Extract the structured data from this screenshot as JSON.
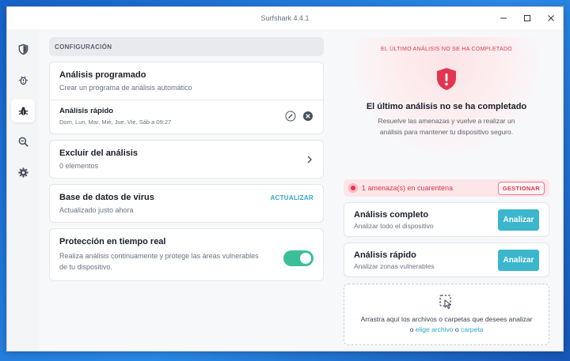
{
  "window": {
    "title": "Surfshark 4.4.1"
  },
  "sidebar": {
    "items": [
      {
        "name": "vpn",
        "icon": "shield-icon"
      },
      {
        "name": "alert",
        "icon": "alert-bug-icon"
      },
      {
        "name": "antivirus",
        "icon": "bug-icon",
        "active": true
      },
      {
        "name": "search",
        "icon": "search-icon"
      },
      {
        "name": "settings",
        "icon": "gear-icon"
      }
    ]
  },
  "config": {
    "header": "CONFIGURACIÓN",
    "scheduled": {
      "title": "Análisis programado",
      "subtitle": "Crear un programa de análisis automático",
      "item": {
        "title": "Análisis rápido",
        "days": "Dom, Lun, Mar, Mié, Jue, Vie, Sáb a 09:27"
      }
    },
    "exclude": {
      "title": "Excluir del análisis",
      "subtitle": "0 elementos"
    },
    "database": {
      "title": "Base de datos de virus",
      "subtitle": "Actualizado justo ahora",
      "action": "ACTUALIZAR"
    },
    "realtime": {
      "title": "Protección en tiempo real",
      "subtitle": "Realiza análisis continuamente y protege las áreas vulnerables de tu dispositivo.",
      "enabled": true
    }
  },
  "status": {
    "label": "EL ÚLTIMO ANÁLISIS NO SE HA COMPLETADO",
    "title": "El último análisis no se ha completado",
    "description": "Resuelve las amenazas y vuelve a realizar un análisis para mantener tu dispositivo seguro."
  },
  "threats": {
    "text": "1 amenaza(s) en cuarentena",
    "action": "GESTIONAR"
  },
  "scans": [
    {
      "title": "Análisis completo",
      "subtitle": "Analizar todo el dispositivo",
      "button": "Analizar"
    },
    {
      "title": "Análisis rápido",
      "subtitle": "Analizar zonas vulnerables",
      "button": "Analizar"
    }
  ],
  "dropzone": {
    "text": "Arrastra aquí los archivos o carpetas que desees analizar",
    "or1": "o",
    "link_file": "elige archivo",
    "or2": "o",
    "link_folder": "carpeta"
  },
  "colors": {
    "accent": "#3bb6cd",
    "danger": "#d8394c",
    "toggle": "#3bbf9a"
  }
}
